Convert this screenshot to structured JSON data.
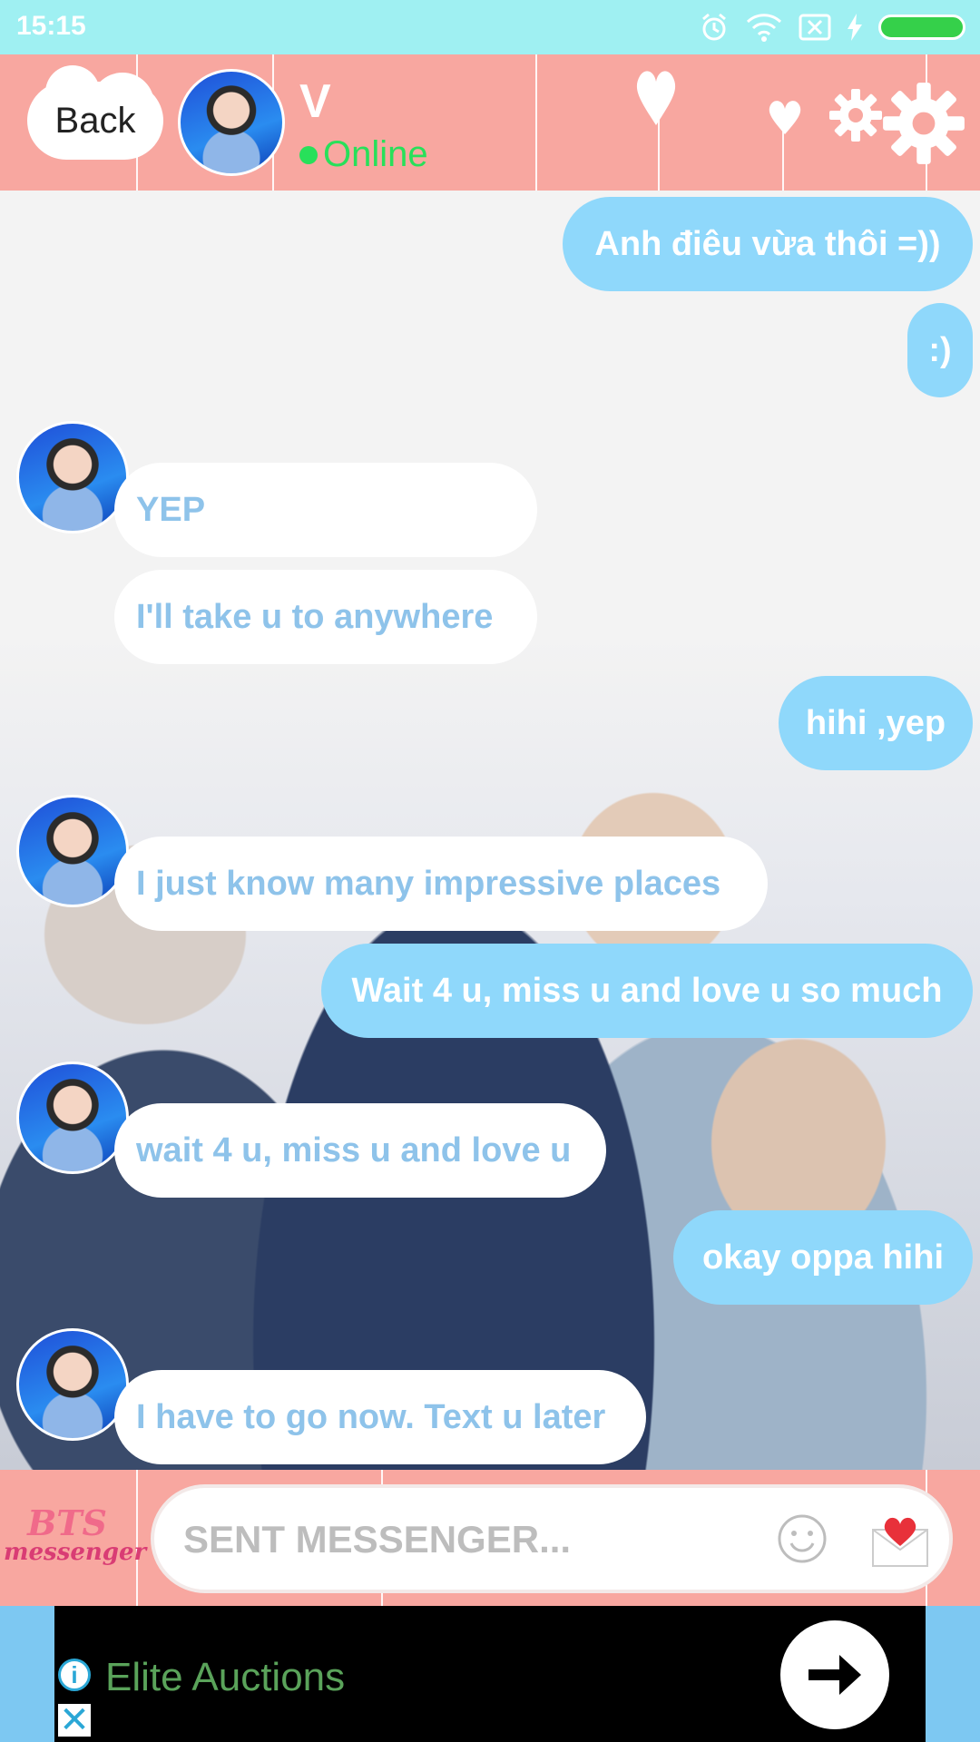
{
  "status_bar": {
    "time": "15:15"
  },
  "header": {
    "back_label": "Back",
    "contact_name": "V",
    "status_text": "Online"
  },
  "messages": [
    {
      "side": "out",
      "text": "Anh điêu vừa thôi =))"
    },
    {
      "side": "out",
      "text": ":)"
    },
    {
      "side": "in",
      "text": "YEP"
    },
    {
      "side": "in",
      "text": "I'll take u to anywhere"
    },
    {
      "side": "out",
      "text": "hihi ,yep"
    },
    {
      "side": "in",
      "text": "I just know many impressive places"
    },
    {
      "side": "out",
      "text": "Wait 4 u, miss u and love u so much"
    },
    {
      "side": "in",
      "text": "wait 4 u, miss u and love u"
    },
    {
      "side": "out",
      "text": "okay oppa hihi"
    },
    {
      "side": "in",
      "text": "I have to go now. Text u later"
    }
  ],
  "input_bar": {
    "logo_line1": "BTS",
    "logo_line2": "messenger",
    "placeholder": "SENT MESSENGER...",
    "emoji_icon": "smile-icon",
    "send_icon": "love-letter-icon"
  },
  "ad": {
    "title": "Elite Auctions",
    "info_glyph": "i",
    "close_glyph": "✕"
  },
  "colors": {
    "status_bar": "#9ff0f2",
    "header_pink": "#f8a7a0",
    "outgoing_bubble": "#8fd8fb",
    "incoming_text": "#8ec3ea",
    "online_green": "#28e05a"
  }
}
